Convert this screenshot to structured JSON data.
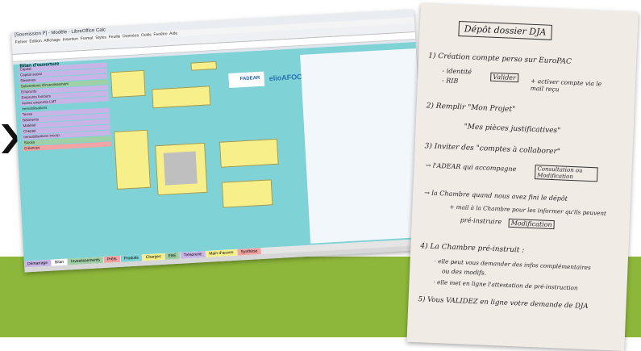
{
  "colors": {
    "background": "#ffffff",
    "green_band": "#8db73a",
    "chevron": "#111111"
  },
  "spreadsheet": {
    "window_title": "[Soumission P] - Modèle - LibreOffice Calc",
    "menu": [
      "Fichier",
      "Édition",
      "Affichage",
      "Insertion",
      "Format",
      "Styles",
      "Feuille",
      "Données",
      "Outils",
      "Fenêtre",
      "Aide"
    ],
    "heading": "Bilan d'ouverture",
    "logo_text": "elioAFOCG",
    "logo_text_2": "FADEAR",
    "row_labels": [
      "Capital",
      "Capital social",
      "Réserves",
      "Subventions d'investissement",
      "Emprunts",
      "Emprunts fonciers",
      "Autres emprunts LMT",
      "Immobilisations",
      "Terres",
      "Bâtiments",
      "Matériel",
      "Cheptel",
      "Immobilisations incorp.",
      "Stocks",
      "Créances"
    ],
    "sheet_tabs": [
      "Démarrage",
      "Bilan",
      "Investissements",
      "Prêts",
      "Produits",
      "Charges",
      "EBE",
      "Trésorerie",
      "Main d'œuvre",
      "Synthèse"
    ]
  },
  "note": {
    "title": "Dépôt dossier DJA",
    "lines": [
      "1) Création compte perso sur EuroPAC",
      "- identité",
      "- RIB",
      "Valider",
      "+ activer compte via le mail reçu",
      "2) Remplir \"Mon Projet\"",
      "\"Mes pièces justificatives\"",
      "3) Inviter des \"comptes à collaborer\"",
      "→ l'ADEAR qui accompagne",
      "Consultation ou Modification",
      "→ la Chambre quand nous avez fini le dépôt",
      "+ mail à la Chambre pour les informer qu'ils peuvent",
      "pré-instruire",
      "Modification",
      "4) La Chambre pré-instruit :",
      "· elle peut vous demander des infos complémentaires",
      "ou des modifs.",
      "· elle met en ligne l'attestation de pré-instruction",
      "5) Vous VALIDEZ en ligne votre demande de DJA"
    ]
  }
}
